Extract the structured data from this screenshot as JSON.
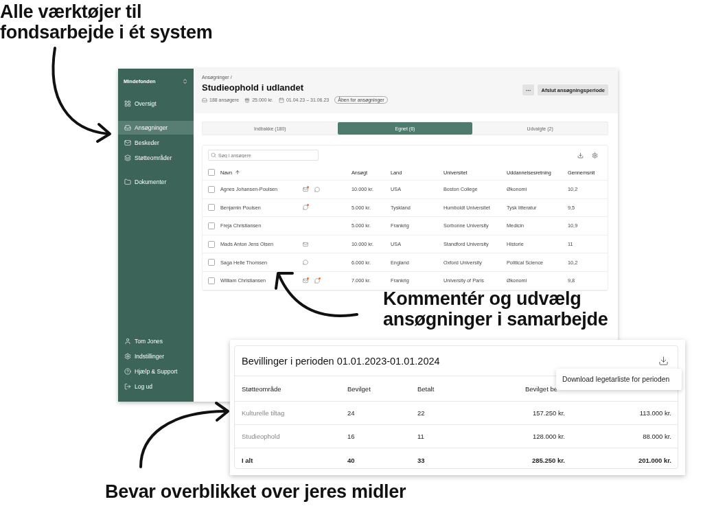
{
  "headline": "Alle værktøjer til fondsarbejde i ét system",
  "app": {
    "sidebar": {
      "org": "Mindefonden",
      "items": [
        {
          "kind": "grid",
          "label": "Oversigt",
          "selected": false
        },
        {
          "kind": "inbox",
          "label": "Ansøgninger",
          "selected": true
        },
        {
          "kind": "mail",
          "label": "Beskeder",
          "selected": false
        },
        {
          "kind": "layers",
          "label": "Støtteområder",
          "selected": false
        },
        {
          "kind": "folder",
          "label": "Dokumenter",
          "selected": false
        }
      ],
      "footer_items": [
        {
          "kind": "user",
          "label": "Tom Jones"
        },
        {
          "kind": "settings",
          "label": "Indstillinger"
        },
        {
          "kind": "help",
          "label": "Hjælp & Support"
        },
        {
          "kind": "logout",
          "label": "Log ud"
        }
      ]
    },
    "breadcrumb": "Ansøgninger /",
    "title": "Studieophold i udlandet",
    "meta": [
      {
        "kind": "applicants",
        "text": "188 ansøgere"
      },
      {
        "kind": "amount",
        "text": "25.000 kr."
      },
      {
        "kind": "dates",
        "text": "01.04.23 – 31.06.23"
      }
    ],
    "status_badge": "Åben for ansøgninger",
    "more_button": "···",
    "close_button": "Afslut ansøgningsperiode",
    "tabs": [
      {
        "label": "Indbakke (180)",
        "selected": false
      },
      {
        "label": "Egnet (6)",
        "selected": true
      },
      {
        "label": "Udvalgte (2)",
        "selected": false
      }
    ],
    "search": {
      "placeholder": "Søg i ansøgere"
    },
    "table": {
      "select_all": {
        "checked": false
      },
      "columns": [
        "Navn",
        "Ansøgt",
        "Land",
        "Universitet",
        "Uddannelsesretning",
        "Gennemsnit"
      ],
      "rows": [
        {
          "checked": false,
          "name": "Agnes Johansen-Poulsen",
          "icons": [
            {
              "kind": "mail",
              "unread": true
            },
            {
              "kind": "comment",
              "unread": false
            }
          ],
          "applied": "10.000 kr.",
          "country": "USA",
          "university": "Boston College",
          "field": "Økonomi",
          "average": "10,2"
        },
        {
          "checked": false,
          "name": "Benjamin Poulsen",
          "icons": [
            {
              "kind": "comment",
              "unread": true
            }
          ],
          "applied": "5.000 kr.",
          "country": "Tyskland",
          "university": "Humboldt Universitet",
          "field": "Tysk litteratur",
          "average": "9,5"
        },
        {
          "checked": false,
          "name": "Freja Christiansen",
          "applied": "5.000 kr.",
          "country": "Frankrig",
          "university": "Sorbonne University",
          "field": "Medicin",
          "average": "10,9"
        },
        {
          "checked": false,
          "name": "Mads Anton Jens Olsen",
          "icons": [
            {
              "kind": "mail",
              "unread": false
            }
          ],
          "applied": "10.000 kr.",
          "country": "USA",
          "university": "Standford University",
          "field": "Historie",
          "average": "11"
        },
        {
          "checked": false,
          "name": "Saga Helle Thomsen",
          "icons": [
            {
              "kind": "comment",
              "unread": false
            }
          ],
          "applied": "6.000 kr.",
          "country": "England",
          "university": "Oxford University",
          "field": "Political Science",
          "average": "10,2"
        },
        {
          "checked": false,
          "name": "William Christiansen",
          "icons": [
            {
              "kind": "mail",
              "unread": true
            },
            {
              "kind": "comment",
              "unread": true
            }
          ],
          "applied": "7.000 kr.",
          "country": "Frankrig",
          "university": "University of Paris",
          "field": "Økonomi",
          "average": "9,8"
        }
      ]
    }
  },
  "callout": "Kommentér og udvælg ansøgninger i samarbejde",
  "grants": {
    "title": "Bevillinger i perioden 01.01.2023-01.01.2024",
    "columns": [
      "Støtteområde",
      "Bevilget",
      "Betalt",
      "Bevilget be"
    ],
    "rows": [
      {
        "kind": "item",
        "cells": [
          "Kulturelle tiltag",
          "24",
          "22",
          "157.250 kr.",
          "113.000 kr."
        ]
      },
      {
        "kind": "item",
        "cells": [
          "Studieophold",
          "16",
          "11",
          "128.000 kr.",
          "88.000 kr."
        ]
      },
      {
        "kind": "total",
        "cells": [
          "I alt",
          "40",
          "33",
          "285.250 kr.",
          "201.000 kr."
        ]
      }
    ],
    "menu": {
      "items": [
        "Download legetarliste for perioden"
      ]
    }
  },
  "footer_headline": "Bevar overblikket over jeres midler"
}
